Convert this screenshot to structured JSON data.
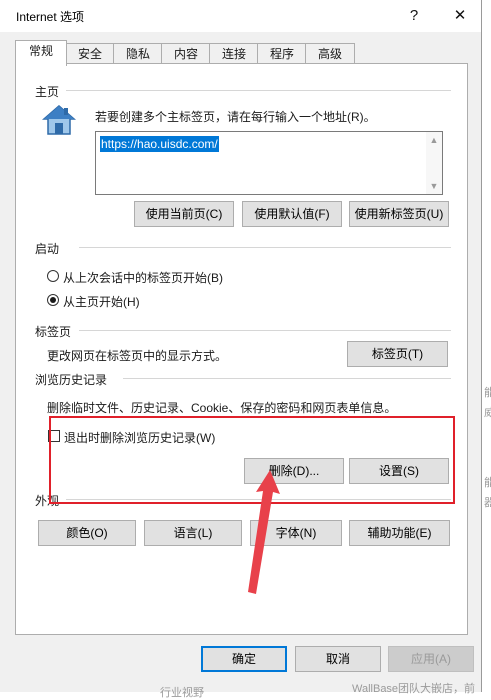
{
  "window": {
    "title": "Internet 选项",
    "help_glyph": "?",
    "close_glyph": "✕"
  },
  "tabs": [
    {
      "label": "常规",
      "active": true
    },
    {
      "label": "安全",
      "active": false
    },
    {
      "label": "隐私",
      "active": false
    },
    {
      "label": "内容",
      "active": false
    },
    {
      "label": "连接",
      "active": false
    },
    {
      "label": "程序",
      "active": false
    },
    {
      "label": "高级",
      "active": false
    }
  ],
  "home": {
    "section_label": "主页",
    "instruction": "若要创建多个主标签页，请在每行输入一个地址(R)。",
    "url_value": "https://hao.uisdc.com/",
    "buttons": [
      "使用当前页(C)",
      "使用默认值(F)",
      "使用新标签页(U)"
    ]
  },
  "startup": {
    "section_label": "启动",
    "options": [
      {
        "label": "从上次会话中的标签页开始(B)",
        "selected": false
      },
      {
        "label": "从主页开始(H)",
        "selected": true
      }
    ]
  },
  "tabs_section": {
    "section_label": "标签页",
    "description": "更改网页在标签页中的显示方式。",
    "button": "标签页(T)"
  },
  "history": {
    "section_label": "浏览历史记录",
    "description": "删除临时文件、历史记录、Cookie、保存的密码和网页表单信息。",
    "checkbox_label": "退出时删除浏览历史记录(W)",
    "checkbox_checked": false,
    "delete_button": "删除(D)...",
    "settings_button": "设置(S)"
  },
  "appearance": {
    "section_label": "外观",
    "buttons": [
      "颜色(O)",
      "语言(L)",
      "字体(N)",
      "辅助功能(E)"
    ]
  },
  "footer": {
    "ok": "确定",
    "cancel": "取消",
    "apply": "应用(A)"
  },
  "background_fragments": [
    "能",
    "威",
    "能",
    "器",
    "行业视野",
    "WallBase团队大嵌店，前"
  ],
  "colors": {
    "highlight_box": "#e0202a",
    "arrow": "#e8414a",
    "accent": "#0078d7"
  }
}
